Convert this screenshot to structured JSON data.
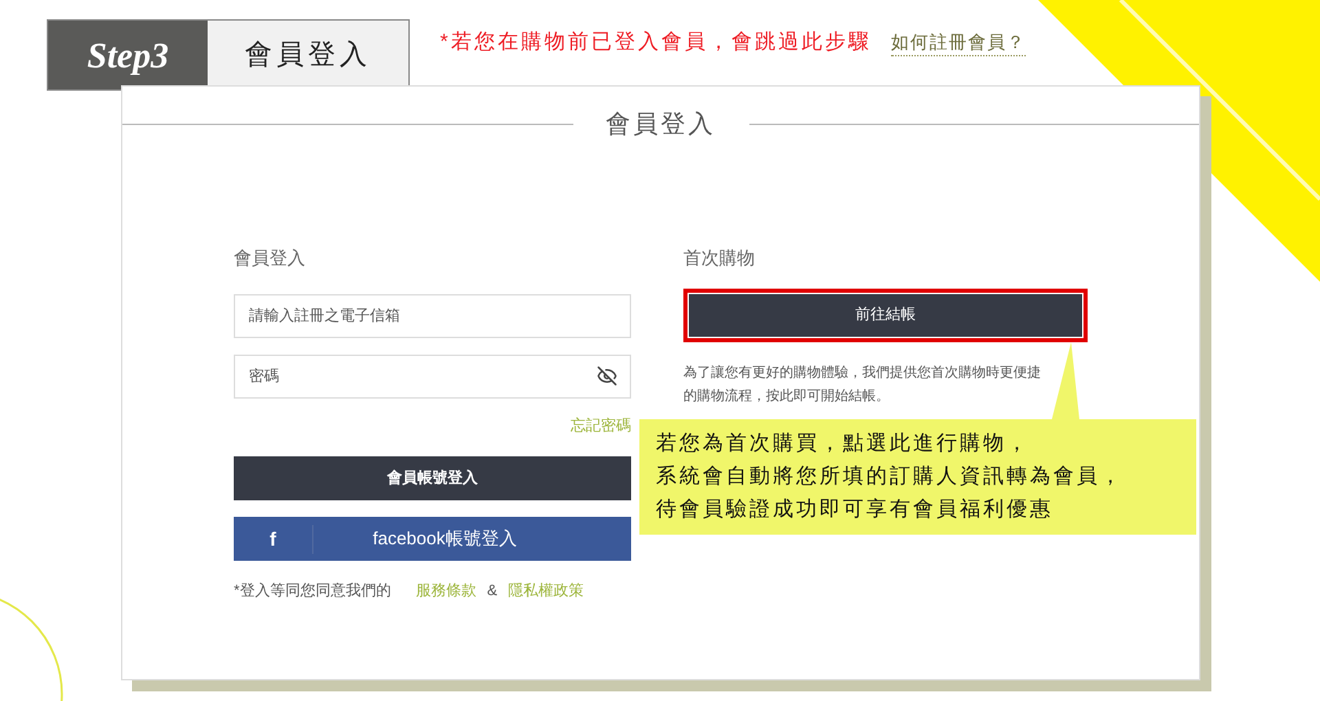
{
  "step": {
    "badge": "Step3",
    "title": "會員登入"
  },
  "notice": "*若您在購物前已登入會員，會跳過此步驟",
  "register_link": "如何註冊會員？",
  "card": {
    "title": "會員登入"
  },
  "login": {
    "heading": "會員登入",
    "email": {
      "placeholder": "請輸入註冊之電子信箱"
    },
    "password": {
      "placeholder": "密碼"
    },
    "forgot": "忘記密碼",
    "submit": "會員帳號登入",
    "facebook_icon": "f",
    "facebook": "facebook帳號登入",
    "terms_prefix": "*登入等同您同意我們的",
    "terms": "服務條款",
    "amp": "&",
    "privacy": "隱私權政策"
  },
  "first_purchase": {
    "heading": "首次購物",
    "checkout": "前往結帳",
    "description": "為了讓您有更好的購物體驗，我們提供您首次購物時更便捷的購物流程，按此即可開始結帳。"
  },
  "callout": [
    "若您為首次購買，點選此進行購物，",
    "系統會自動將您所填的訂購人資訊轉為會員，",
    "待會員驗證成功即可享有會員福利優惠"
  ]
}
